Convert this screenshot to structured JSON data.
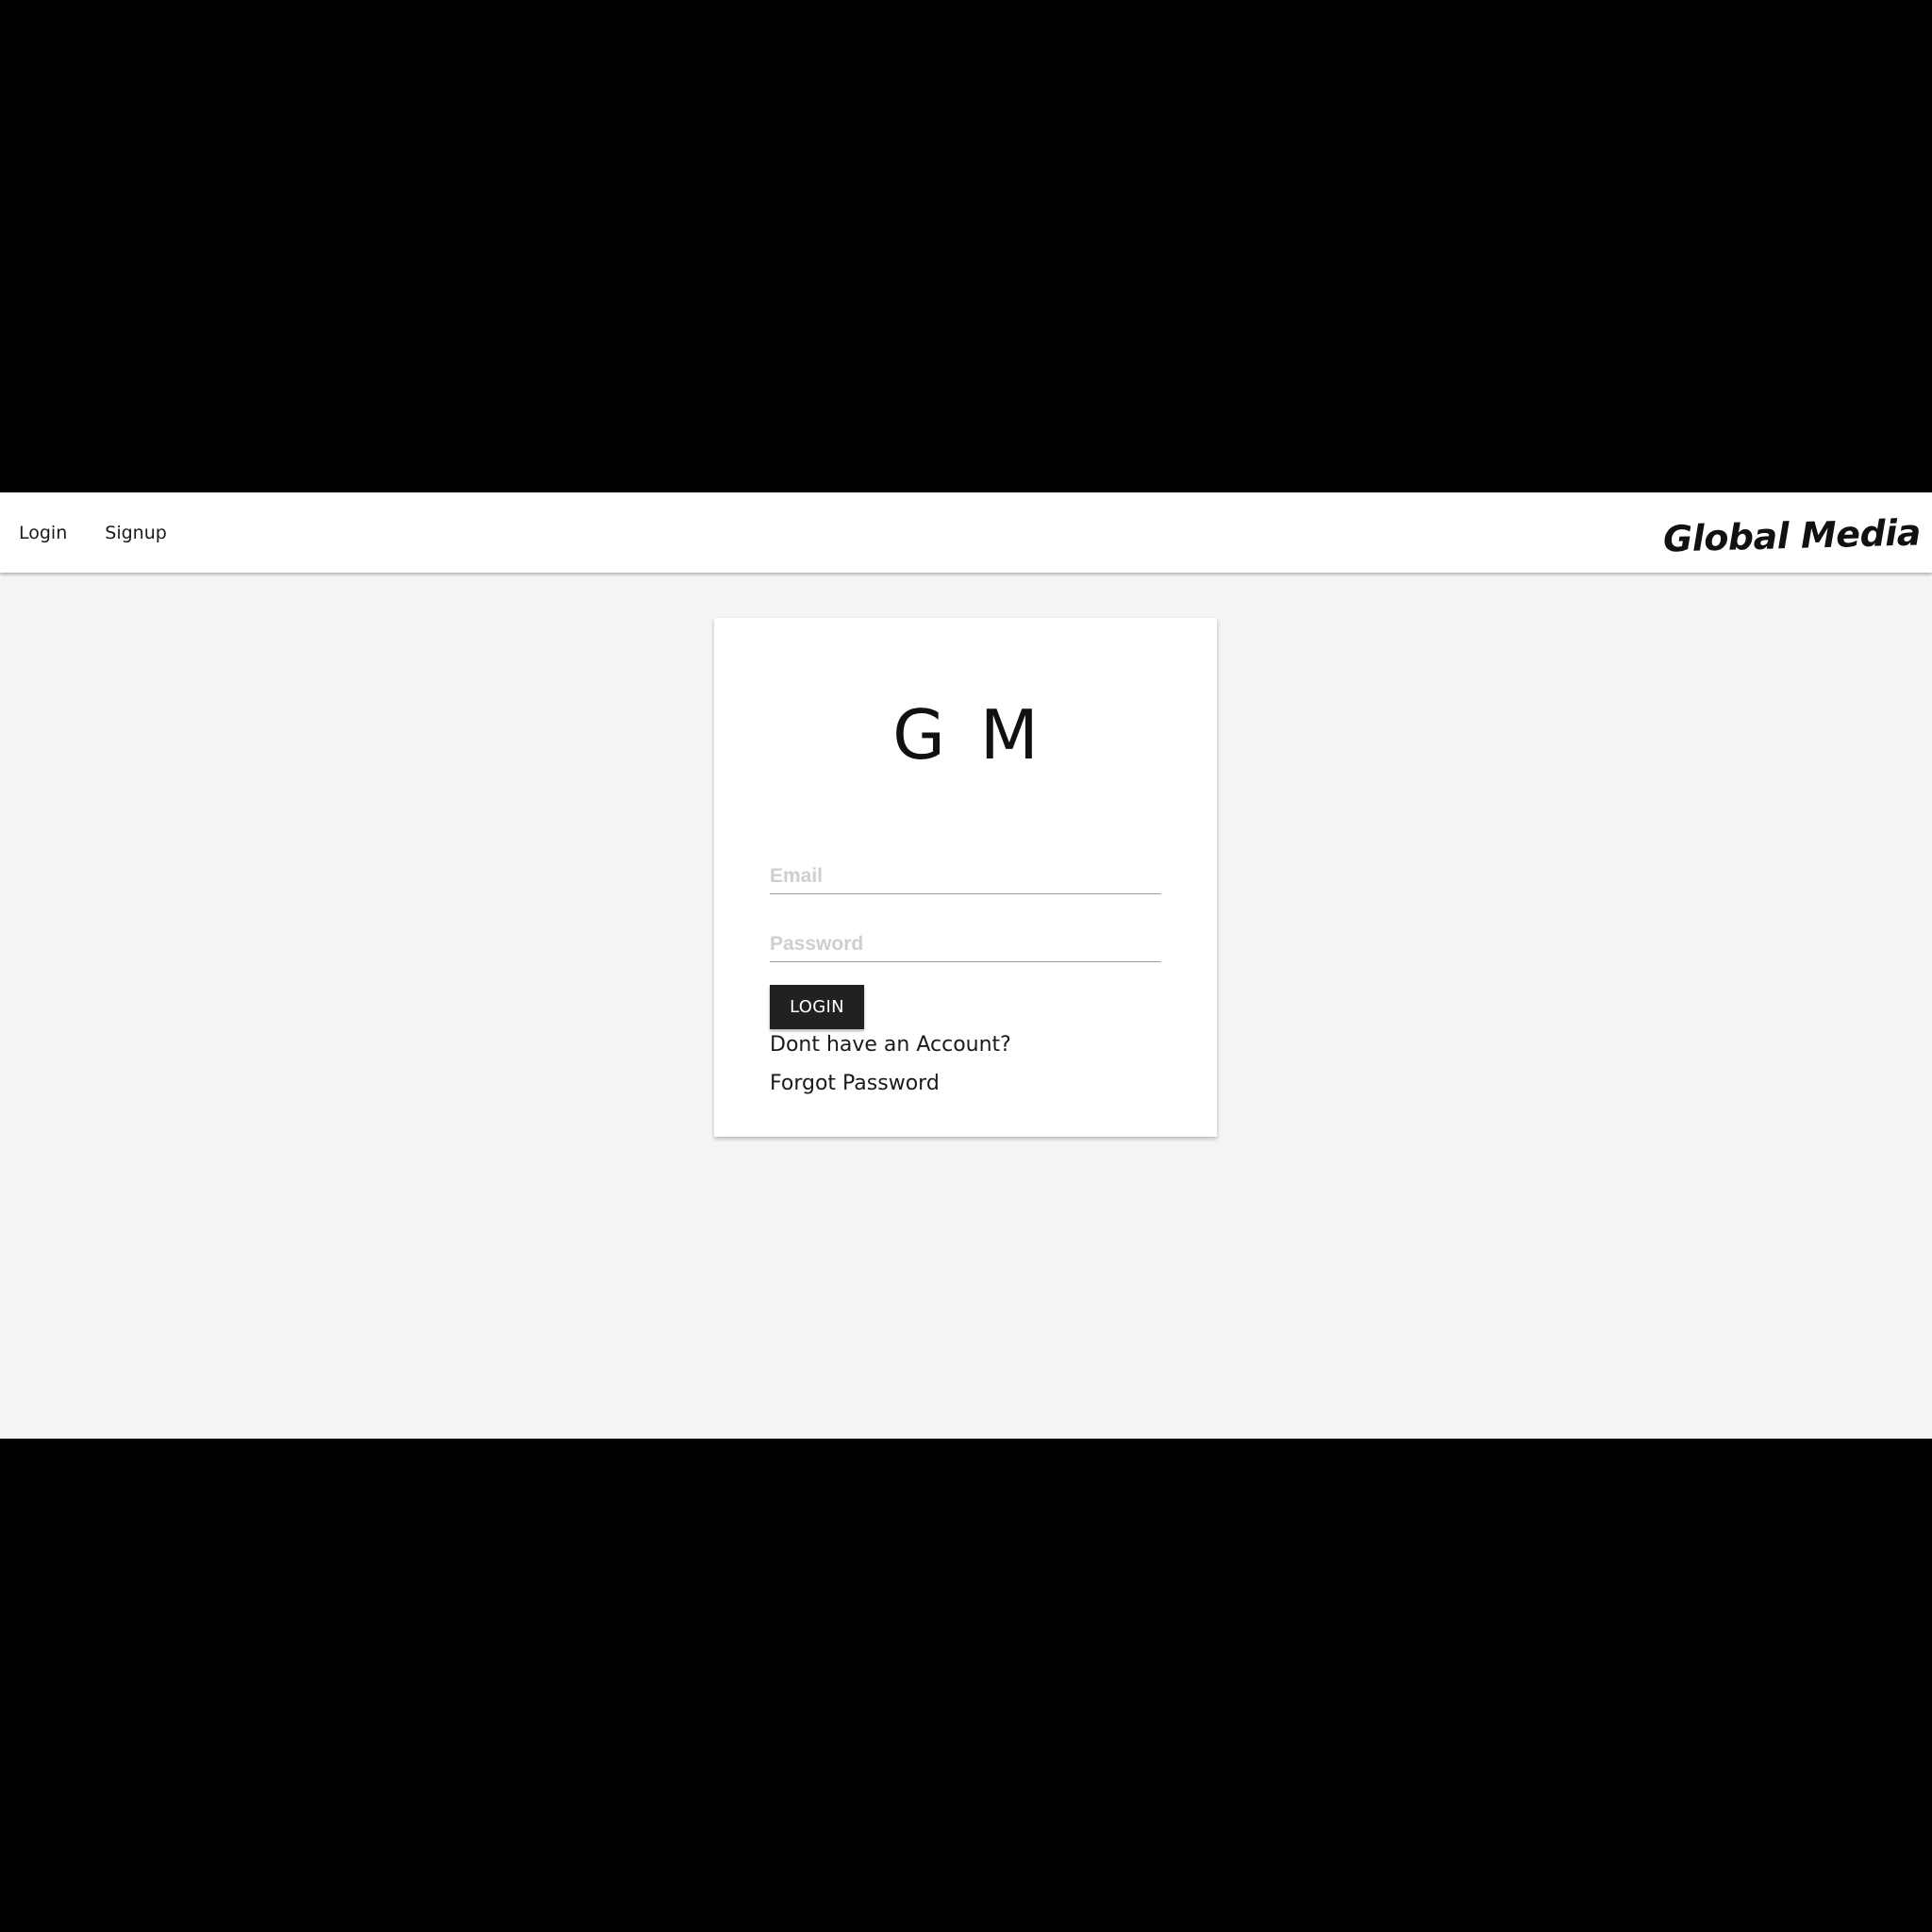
{
  "navbar": {
    "links": [
      "Login",
      "Signup"
    ],
    "brand": "Global Media"
  },
  "login_card": {
    "logo": "G M",
    "email_placeholder": "Email",
    "password_placeholder": "Password",
    "login_button": "LOGIN",
    "signup_link": "Dont have an Account?",
    "forgot_link": "Forgot Password"
  },
  "colors": {
    "page_background": "#f4f4f4",
    "navbar_background": "#ffffff",
    "button_background": "#212121",
    "letterbox": "#000000"
  }
}
